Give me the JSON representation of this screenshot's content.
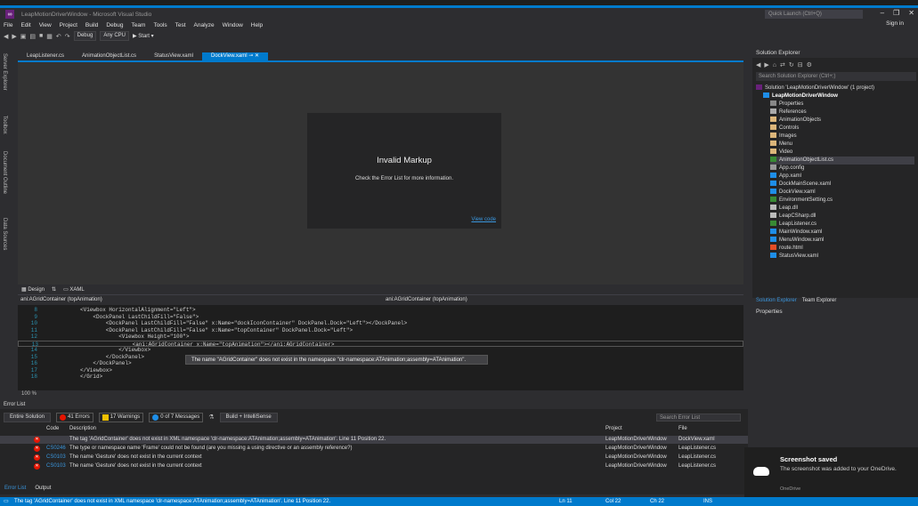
{
  "window": {
    "title": "LeapMotionDriverWindow - Microsoft Visual Studio",
    "quick_launch": "Quick Launch (Ctrl+Q)",
    "sign_in": "Sign in"
  },
  "menu": [
    "File",
    "Edit",
    "View",
    "Project",
    "Build",
    "Debug",
    "Team",
    "Tools",
    "Test",
    "Analyze",
    "Window",
    "Help"
  ],
  "toolbar": {
    "config": "Debug",
    "platform": "Any CPU",
    "start": "▶ Start ▾"
  },
  "doc_tabs": [
    "LeapListener.cs",
    "AnimationObjectList.cs",
    "StatusView.xaml",
    "DockView.xaml"
  ],
  "left_tabs": [
    "Server Explorer",
    "Toolbox",
    "Document Outline",
    "Data Sources"
  ],
  "designer": {
    "invalid_title": "Invalid Markup",
    "invalid_sub": "Check the Error List for more information.",
    "view_code": "View code"
  },
  "split": {
    "design": "Design",
    "xaml": "XAML"
  },
  "path": {
    "left": "ani:AGridContainer (topAnimation)",
    "right": "ani:AGridContainer (topAnimation)"
  },
  "code_lines": [
    {
      "n": "8",
      "text": "<Viewbox HorizontalAlignment=\"Left\">"
    },
    {
      "n": "9",
      "text": "    <DockPanel LastChildFill=\"False\">"
    },
    {
      "n": "10",
      "text": "        <DockPanel LastChildFill=\"False\" x:Name=\"dockIconContainer\" DockPanel.Dock=\"Left\"></DockPanel>"
    },
    {
      "n": "11",
      "text": "        <DockPanel LastChildFill=\"False\" x:Name=\"topContainer\" DockPanel.Dock=\"Left\">"
    },
    {
      "n": "12",
      "text": "            <Viewbox Height=\"100\">"
    },
    {
      "n": "13",
      "text": "                <ani:AGridContainer x:Name=\"topAnimation\"></ani:AGridContainer>"
    },
    {
      "n": "14",
      "text": "            </Viewbox>"
    },
    {
      "n": "15",
      "text": "        </DockPanel>"
    },
    {
      "n": "16",
      "text": "    </DockPanel>"
    },
    {
      "n": "17",
      "text": "</Viewbox>"
    },
    {
      "n": "18",
      "text": "</Grid>"
    }
  ],
  "tooltip": "The name \"AGridContainer\" does not exist in the namespace \"clr-namespace:ATAnimation;assembly=ATAnimation\".",
  "zoom": "100 %",
  "error_list": {
    "title": "Error List",
    "scope": "Entire Solution",
    "errors": "41 Errors",
    "warnings": "17 Warnings",
    "messages": "0 of 7 Messages",
    "build": "Build + IntelliSense",
    "search": "Search Error List",
    "cols": {
      "code": "Code",
      "desc": "Description",
      "project": "Project",
      "file": "File"
    },
    "rows": [
      {
        "code": "",
        "desc": "The tag 'AGridContainer' does not exist in XML namespace 'clr-namespace:ATAnimation;assembly=ATAnimation'. Line 11 Position 22.",
        "project": "LeapMotionDriverWindow",
        "file": "DockView.xaml"
      },
      {
        "code": "CS0246",
        "desc": "The type or namespace name 'Frame' could not be found (are you missing a using directive or an assembly reference?)",
        "project": "LeapMotionDriverWindow",
        "file": "LeapListener.cs"
      },
      {
        "code": "CS0103",
        "desc": "The name 'Gesture' does not exist in the current context",
        "project": "LeapMotionDriverWindow",
        "file": "LeapListener.cs"
      },
      {
        "code": "CS0103",
        "desc": "The name 'Gesture' does not exist in the current context",
        "project": "LeapMotionDriverWindow",
        "file": "LeapListener.cs"
      }
    ],
    "tabs": [
      "Error List",
      "Output"
    ]
  },
  "solution_explorer": {
    "title": "Solution Explorer",
    "search": "Search Solution Explorer (Ctrl+;)",
    "items": [
      {
        "label": "Solution 'LeapMotionDriverWindow' (1 project)",
        "indent": 0
      },
      {
        "label": "LeapMotionDriverWindow",
        "indent": 1
      },
      {
        "label": "Properties",
        "indent": 2
      },
      {
        "label": "References",
        "indent": 2
      },
      {
        "label": "AnimationObjects",
        "indent": 2
      },
      {
        "label": "Controls",
        "indent": 2
      },
      {
        "label": "Images",
        "indent": 2
      },
      {
        "label": "Menu",
        "indent": 2
      },
      {
        "label": "Video",
        "indent": 2
      },
      {
        "label": "AnimationObjectList.cs",
        "indent": 2
      },
      {
        "label": "App.config",
        "indent": 2
      },
      {
        "label": "App.xaml",
        "indent": 2
      },
      {
        "label": "DockMainScene.xaml",
        "indent": 2
      },
      {
        "label": "DockView.xaml",
        "indent": 2
      },
      {
        "label": "EnvironmentSetting.cs",
        "indent": 2
      },
      {
        "label": "Leap.dll",
        "indent": 2
      },
      {
        "label": "LeapCSharp.dll",
        "indent": 2
      },
      {
        "label": "LeapListener.cs",
        "indent": 2
      },
      {
        "label": "MainWindow.xaml",
        "indent": 2
      },
      {
        "label": "MenuWindow.xaml",
        "indent": 2
      },
      {
        "label": "route.html",
        "indent": 2
      },
      {
        "label": "StatusView.xaml",
        "indent": 2
      }
    ],
    "tabs": [
      "Solution Explorer",
      "Team Explorer"
    ]
  },
  "properties": {
    "title": "Properties"
  },
  "toast": {
    "title": "Screenshot saved",
    "body": "The screenshot was added to your OneDrive.",
    "source": "OneDrive"
  },
  "status": {
    "message": "The tag 'AGridContainer' does not exist in XML namespace 'clr-namespace:ATAnimation;assembly=ATAnimation'. Line 11 Position 22.",
    "ln": "Ln 11",
    "col": "Col 22",
    "ch": "Ch 22",
    "ins": "INS"
  },
  "colors": {
    "accent": "#007acc",
    "error": "#e51400",
    "warning": "#f0c000",
    "info": "#1e8ee8"
  }
}
